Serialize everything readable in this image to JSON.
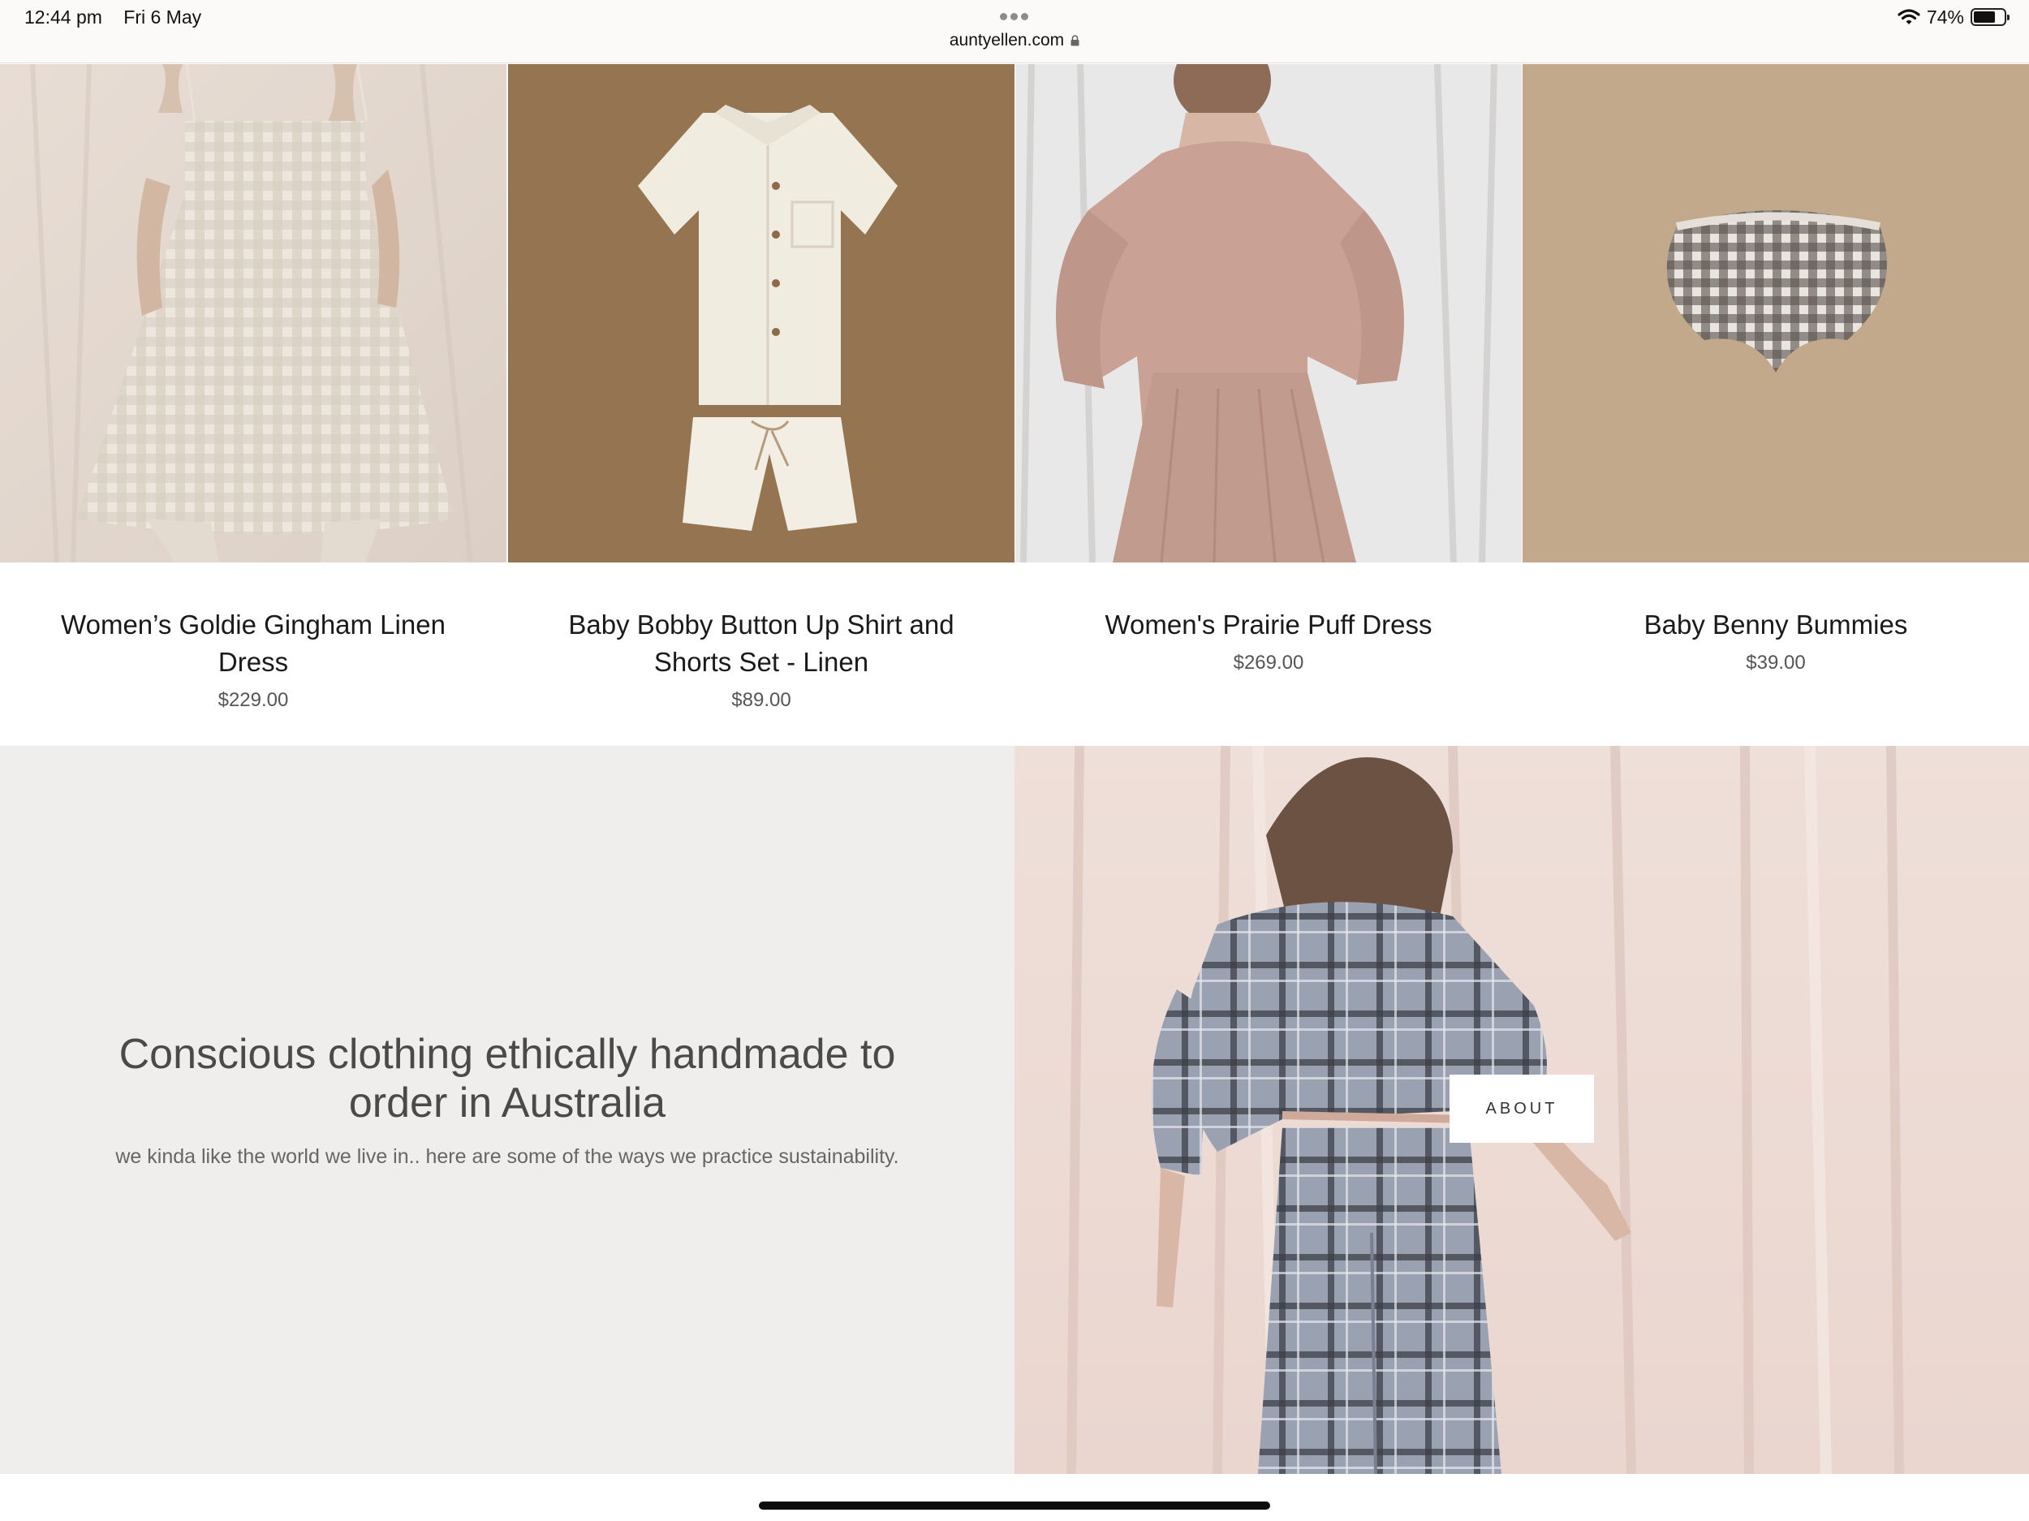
{
  "status_bar": {
    "time": "12:44 pm",
    "date": "Fri 6 May",
    "url": "auntyellen.com",
    "battery_percent": "74%",
    "battery_level": 0.74,
    "icons": [
      "more-dots-icon",
      "lock-icon",
      "wifi-icon",
      "battery-icon"
    ]
  },
  "products": [
    {
      "name": "Women’s Goldie Gingham Linen Dress",
      "price": "$229.00"
    },
    {
      "name": "Baby Bobby Button Up Shirt and Shorts Set - Linen",
      "price": "$89.00"
    },
    {
      "name": "Women's Prairie Puff Dress",
      "price": "$269.00"
    },
    {
      "name": "Baby Benny Bummies",
      "price": "$39.00"
    }
  ],
  "about": {
    "heading": "Conscious clothing ethically handmade to order in Australia",
    "subtext": "we kinda like the world we live in.. here are some of the ways we practice sustainability.",
    "button_label": "ABOUT"
  },
  "colors": {
    "about_panel_bg": "#efeeec",
    "status_bar_bg": "#fbfaf9"
  }
}
